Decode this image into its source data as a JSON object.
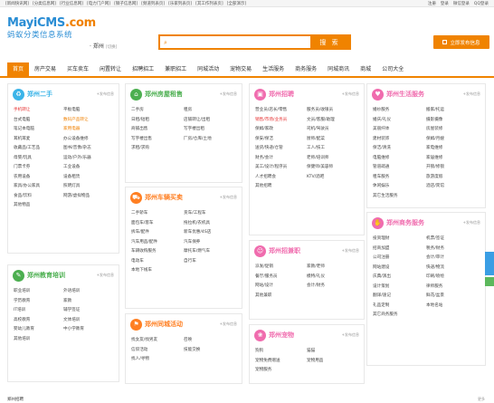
{
  "topbar": {
    "links": [
      "[新闻快讯网]",
      "[分类信息网]",
      "[行业信息网]",
      "[电力门户网]",
      "[钢子信息网]",
      "[频道列表页]",
      "[乐家列表页]",
      "[其工作列表页]",
      "[全部演示]"
    ],
    "right": [
      "注册",
      "登录",
      "微信登录",
      "QQ登录"
    ]
  },
  "logo": {
    "line1_main": "MayiCMS",
    "line1_com": ".com",
    "line2": "蚂蚁分类信息系统"
  },
  "city": {
    "name": "郑州",
    "switch": "[切换]"
  },
  "search": {
    "placeholder": "",
    "button": "搜 索"
  },
  "post_button": "立即发布信息",
  "nav": [
    "首页",
    "房产交易",
    "买车卖车",
    "闲置转让",
    "招聘招工",
    "兼职招工",
    "同城活动",
    "宠物交易",
    "生活服务",
    "商务服务",
    "同城商讯",
    "商城",
    "公司大全"
  ],
  "panels": {
    "ershou": {
      "title": "郑州二手",
      "more": "+发布信息",
      "color": "#3bb4e8",
      "icon": "recycle-icon",
      "items": [
        "手机转让",
        "平板电脑",
        "台式电脑",
        "数码产品转让",
        "笔记本电脑",
        "家用电器",
        "耳机耳麦",
        "办公设备维修",
        "收藏品/工艺品",
        "图书/音像/杂志",
        "母婴/玩具",
        "运动/户外/乐器",
        "门票卡券",
        "工业设备",
        "农用设备",
        "设备租赁",
        "家具/办公家具",
        "照明灯具",
        "食品/饮料",
        "网游/虚拟物品",
        "其他物品",
        ""
      ]
    },
    "jiaoyu": {
      "title": "郑州教育培训",
      "more": "+发布信息",
      "color": "#4caf50",
      "icon": "graduation-icon",
      "items": [
        "职业培训",
        "外语培训",
        "学历教育",
        "家教",
        "IT培训",
        "辅学签证",
        "高校教育",
        "文体培训",
        "婴幼儿教育",
        "中小学教育",
        "其他培训",
        ""
      ]
    },
    "fangwu": {
      "title": "郑州房屋租售",
      "more": "+发布信息",
      "color": "#4caf50",
      "icon": "house-icon",
      "items": [
        "二手房",
        "租房",
        "日租/短租",
        "店铺转让/出租",
        "商铺出售",
        "写字楼出租",
        "写字楼出售",
        "厂房/仓库/土地",
        "求租/求购",
        ""
      ]
    },
    "cheliang": {
      "title": "郑州车辆买卖",
      "more": "+发布信息",
      "color": "#ff7f22",
      "icon": "car-icon",
      "items": [
        "二手轿车",
        "货车/工程车",
        "面包车/客车",
        "拖拉机/农机具",
        "拆车/配件",
        "新车优惠/4S店",
        "汽车用品/配件",
        "汽车保养",
        "车辆收购服务",
        "摩托车/燃气车",
        "电动车",
        "自行车",
        "本地下线车",
        ""
      ]
    },
    "huodong": {
      "title": "郑州同城活动",
      "more": "+发布信息",
      "color": "#ff7f22",
      "icon": "flag-icon",
      "items": [
        "找女友/找男友",
        "召唤",
        "信仰活动",
        "技能交换",
        "找人/寻物",
        ""
      ]
    },
    "zhaopin": {
      "title": "郑州招聘",
      "more": "+发布信息",
      "color": "#f06cae",
      "icon": "briefcase-icon",
      "items": [
        "营业员/店长/零售",
        "服务员/收银员",
        "销售/市场/业务员",
        "文员/客服/助理",
        "保姆/家政",
        "司机/驾驶员",
        "保安/保洁",
        "厨师/配菜",
        "送货/快递/仓管",
        "工人/技工",
        "财务/会计",
        "老师/培训师",
        "美工/设计/程序员",
        "保健师/美容师",
        "人才招聘会",
        "KTV/酒吧",
        "其他招聘",
        ""
      ]
    },
    "jianzhi": {
      "title": "郑州招兼职",
      "more": "+发布信息",
      "color": "#f06cae",
      "icon": "person-icon",
      "items": [
        "派发/促销",
        "家教/老师",
        "餐厅/服务员",
        "模特/礼仪",
        "网站/设计",
        "会计/财务",
        "其他兼职",
        ""
      ]
    },
    "chongwu": {
      "title": "郑州宠物",
      "more": "+发布信息",
      "color": "#f06cae",
      "icon": "paw-icon",
      "items": [
        "狗狗",
        "猫猫",
        "宠物免费赠送",
        "宠物用品",
        "宠物服务",
        ""
      ]
    },
    "shenghuo": {
      "title": "郑州生活服务",
      "more": "+发布信息",
      "color": "#f06cae",
      "icon": "heart-icon",
      "items": [
        "婚纱服务",
        "搬家/托运",
        "婚庆/礼仪",
        "摄影摄像",
        "美丽纤体",
        "房屋装修",
        "建材装饰",
        "保姆/月嫂",
        "保洁/清洗",
        "家电维修",
        "电脑维修",
        "家居维修",
        "管道疏通",
        "开锁/修锁",
        "租车服务",
        "旅游度假",
        "休闲娱乐",
        "酒店/宾馆",
        "其它生活服务",
        ""
      ]
    },
    "shangwu": {
      "title": "郑州商务服务",
      "more": "+发布信息",
      "color": "#f06cae",
      "icon": "handshake-icon",
      "items": [
        "投资理财",
        "机票/签证",
        "招商加盟",
        "税务/财务",
        "公司注册",
        "会计/审计",
        "网站建设",
        "快递/物流",
        "庆典/演出",
        "印刷/喷绘",
        "设计策划",
        "律师服务",
        "翻译/速记",
        "鲜花/盆景",
        "礼品定制",
        "本地名站",
        "其它商务服务",
        ""
      ]
    }
  },
  "footer": {
    "left": "郑州招聘",
    "right": "更多"
  }
}
